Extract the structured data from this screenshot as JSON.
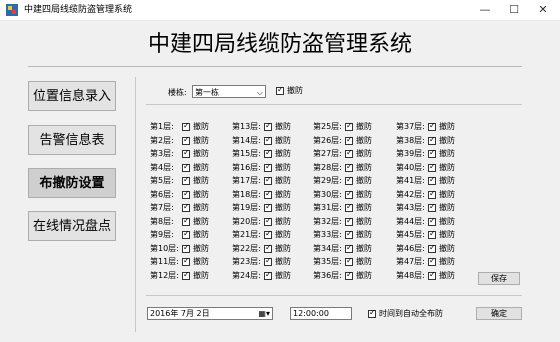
{
  "window": {
    "title": "中建四局线缆防盗管理系统",
    "controls": [
      "—",
      "☐",
      "✕"
    ]
  },
  "header": {
    "title": "中建四局线缆防盗管理系统"
  },
  "nav": [
    {
      "label": "位置信息录入",
      "active": false
    },
    {
      "label": "告警信息表",
      "active": false
    },
    {
      "label": "布撤防设置",
      "active": true
    },
    {
      "label": "在线情况盘点",
      "active": false
    }
  ],
  "building": {
    "label": "楼栋:",
    "selected": "第一栋",
    "arm_all_label": "撤防",
    "arm_all_checked": true
  },
  "floors": {
    "state_label": "撤防",
    "labels": [
      "第1层:",
      "第2层:",
      "第3层:",
      "第4层:",
      "第5层:",
      "第6层:",
      "第7层:",
      "第8层:",
      "第9层:",
      "第10层:",
      "第11层:",
      "第12层:",
      "第13层:",
      "第14层:",
      "第15层:",
      "第16层:",
      "第17层:",
      "第18层:",
      "第19层:",
      "第20层:",
      "第21层:",
      "第22层:",
      "第23层:",
      "第24层:",
      "第25层:",
      "第26层:",
      "第27层:",
      "第28层:",
      "第29层:",
      "第30层:",
      "第31层:",
      "第32层:",
      "第33层:",
      "第34层:",
      "第35层:",
      "第36层:",
      "第37层:",
      "第38层:",
      "第39层:",
      "第40层:",
      "第41层:",
      "第42层:",
      "第43层:",
      "第44层:",
      "第45层:",
      "第46层:",
      "第47层:",
      "第48层:"
    ]
  },
  "save_button": "保存",
  "schedule": {
    "date": "2016年 7月 2日",
    "time": "12:00:00",
    "auto_label": "时间到自动全布防",
    "auto_checked": true,
    "confirm_button": "确定"
  },
  "colors": {
    "client_bg": "#f0f0f0",
    "button_bg": "#e1e1e1"
  }
}
